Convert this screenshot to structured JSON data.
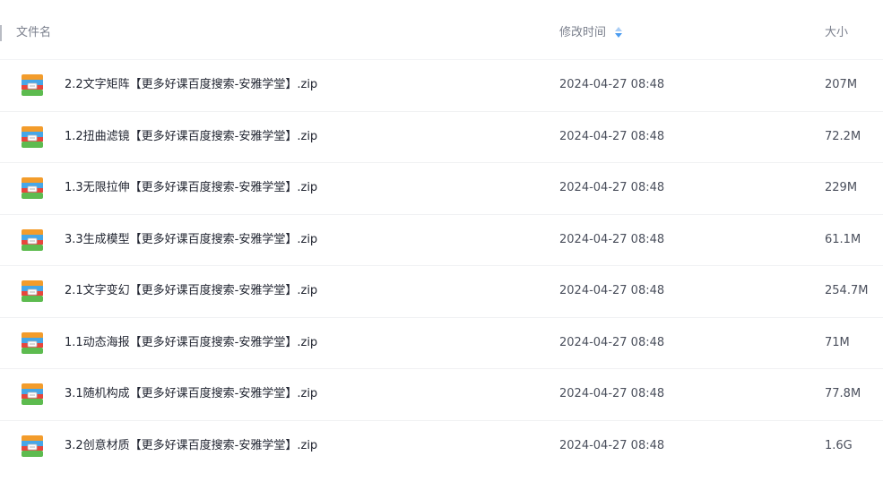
{
  "header": {
    "name_label": "文件名",
    "time_label": "修改时间",
    "size_label": "大小",
    "sort_icon": "sort-updown-icon",
    "sort_color": "#4c9cf0"
  },
  "files": [
    {
      "name": "2.2文字矩阵【更多好课百度搜索-安雅学堂】.zip",
      "modified": "2024-04-27 08:48",
      "size": "207M",
      "icon": "zip-archive-icon"
    },
    {
      "name": "1.2扭曲滤镜【更多好课百度搜索-安雅学堂】.zip",
      "modified": "2024-04-27 08:48",
      "size": "72.2M",
      "icon": "zip-archive-icon"
    },
    {
      "name": "1.3无限拉伸【更多好课百度搜索-安雅学堂】.zip",
      "modified": "2024-04-27 08:48",
      "size": "229M",
      "icon": "zip-archive-icon"
    },
    {
      "name": "3.3生成模型【更多好课百度搜索-安雅学堂】.zip",
      "modified": "2024-04-27 08:48",
      "size": "61.1M",
      "icon": "zip-archive-icon"
    },
    {
      "name": "2.1文字变幻【更多好课百度搜索-安雅学堂】.zip",
      "modified": "2024-04-27 08:48",
      "size": "254.7M",
      "icon": "zip-archive-icon"
    },
    {
      "name": "1.1动态海报【更多好课百度搜索-安雅学堂】.zip",
      "modified": "2024-04-27 08:48",
      "size": "71M",
      "icon": "zip-archive-icon"
    },
    {
      "name": "3.1随机构成【更多好课百度搜索-安雅学堂】.zip",
      "modified": "2024-04-27 08:48",
      "size": "77.8M",
      "icon": "zip-archive-icon"
    },
    {
      "name": "3.2创意材质【更多好课百度搜索-安雅学堂】.zip",
      "modified": "2024-04-27 08:48",
      "size": "1.6G",
      "icon": "zip-archive-icon"
    }
  ]
}
